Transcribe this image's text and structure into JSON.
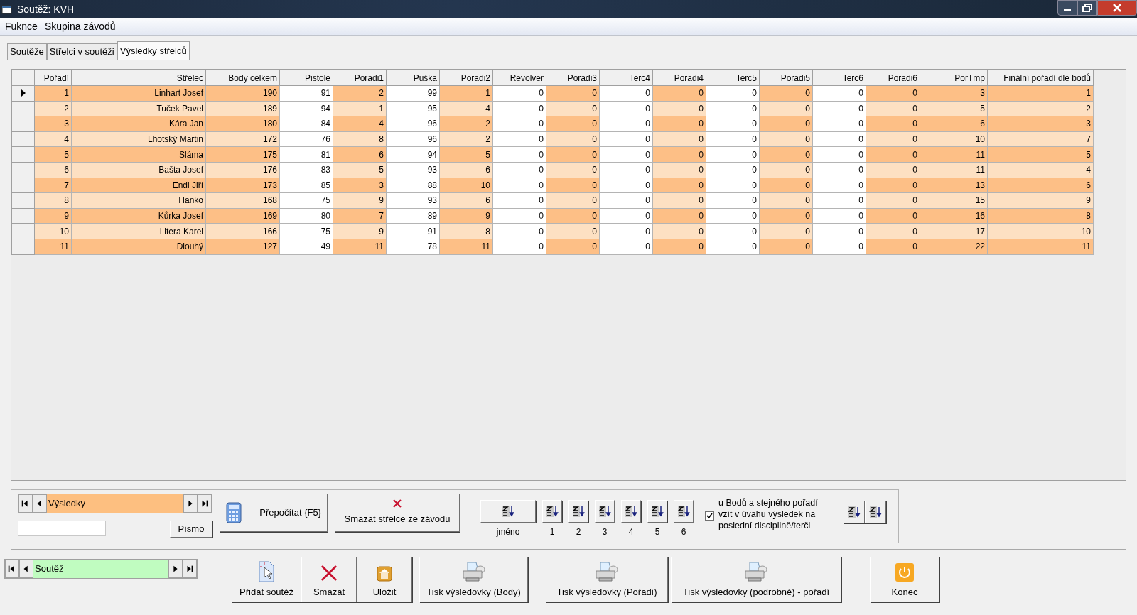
{
  "window": {
    "title": "Soutěž: KVH"
  },
  "menu": [
    "Fuknce",
    "Skupina závodů"
  ],
  "tabs": [
    {
      "label": "Soutěže",
      "selected": false
    },
    {
      "label": "Střelci v soutěži",
      "selected": false
    },
    {
      "label": "Výsledky střelců",
      "selected": true
    }
  ],
  "grid": {
    "columns": [
      {
        "label": "Pořadí",
        "shaded": true
      },
      {
        "label": "Střelec",
        "shaded": true
      },
      {
        "label": "Body celkem",
        "shaded": true
      },
      {
        "label": "Pistole",
        "shaded": false
      },
      {
        "label": "Poradi1",
        "shaded": true
      },
      {
        "label": "Puška",
        "shaded": false
      },
      {
        "label": "Poradi2",
        "shaded": true
      },
      {
        "label": "Revolver",
        "shaded": false
      },
      {
        "label": "Poradi3",
        "shaded": true
      },
      {
        "label": "Terc4",
        "shaded": false
      },
      {
        "label": "Poradi4",
        "shaded": true
      },
      {
        "label": "Terc5",
        "shaded": false
      },
      {
        "label": "Poradi5",
        "shaded": true
      },
      {
        "label": "Terc6",
        "shaded": false
      },
      {
        "label": "Poradi6",
        "shaded": true
      },
      {
        "label": "PorTmp",
        "shaded": true
      },
      {
        "label": "Finální pořadí dle bodů",
        "shaded": true
      }
    ],
    "rows": [
      {
        "selected": true,
        "cells": [
          "1",
          "Linhart Josef",
          "190",
          "91",
          "2",
          "99",
          "1",
          "0",
          "0",
          "0",
          "0",
          "0",
          "0",
          "0",
          "0",
          "3",
          "1"
        ]
      },
      {
        "selected": false,
        "cells": [
          "2",
          "Tuček Pavel",
          "189",
          "94",
          "1",
          "95",
          "4",
          "0",
          "0",
          "0",
          "0",
          "0",
          "0",
          "0",
          "0",
          "5",
          "2"
        ]
      },
      {
        "selected": false,
        "cells": [
          "3",
          "Kára Jan",
          "180",
          "84",
          "4",
          "96",
          "2",
          "0",
          "0",
          "0",
          "0",
          "0",
          "0",
          "0",
          "0",
          "6",
          "3"
        ]
      },
      {
        "selected": false,
        "cells": [
          "4",
          "Lhotský Martin",
          "172",
          "76",
          "8",
          "96",
          "2",
          "0",
          "0",
          "0",
          "0",
          "0",
          "0",
          "0",
          "0",
          "10",
          "7"
        ]
      },
      {
        "selected": false,
        "cells": [
          "5",
          "Sláma",
          "175",
          "81",
          "6",
          "94",
          "5",
          "0",
          "0",
          "0",
          "0",
          "0",
          "0",
          "0",
          "0",
          "11",
          "5"
        ]
      },
      {
        "selected": false,
        "cells": [
          "6",
          "Bašta Josef",
          "176",
          "83",
          "5",
          "93",
          "6",
          "0",
          "0",
          "0",
          "0",
          "0",
          "0",
          "0",
          "0",
          "11",
          "4"
        ]
      },
      {
        "selected": false,
        "cells": [
          "7",
          "Endl Jiří",
          "173",
          "85",
          "3",
          "88",
          "10",
          "0",
          "0",
          "0",
          "0",
          "0",
          "0",
          "0",
          "0",
          "13",
          "6"
        ]
      },
      {
        "selected": false,
        "cells": [
          "8",
          "Hanko",
          "168",
          "75",
          "9",
          "93",
          "6",
          "0",
          "0",
          "0",
          "0",
          "0",
          "0",
          "0",
          "0",
          "15",
          "9"
        ]
      },
      {
        "selected": false,
        "cells": [
          "9",
          "Kůrka Josef",
          "169",
          "80",
          "7",
          "89",
          "9",
          "0",
          "0",
          "0",
          "0",
          "0",
          "0",
          "0",
          "0",
          "16",
          "8"
        ]
      },
      {
        "selected": false,
        "cells": [
          "10",
          "Litera Karel",
          "166",
          "75",
          "9",
          "91",
          "8",
          "0",
          "0",
          "0",
          "0",
          "0",
          "0",
          "0",
          "0",
          "17",
          "10"
        ]
      },
      {
        "selected": false,
        "cells": [
          "11",
          "Dlouhý",
          "127",
          "49",
          "11",
          "78",
          "11",
          "0",
          "0",
          "0",
          "0",
          "0",
          "0",
          "0",
          "0",
          "22",
          "11"
        ]
      }
    ]
  },
  "results_panel": {
    "navigator": {
      "value": "Výsledky",
      "color": "#fdbf80"
    },
    "font_button": "Písmo",
    "recalc_button": "Přepočítat {F5}",
    "delete_button": "Smazat střelce ze závodu",
    "sort_buttons": [
      {
        "label": "jméno",
        "kind": "wide"
      },
      {
        "label": "1",
        "kind": "small"
      },
      {
        "label": "2",
        "kind": "small"
      },
      {
        "label": "3",
        "kind": "small"
      },
      {
        "label": "4",
        "kind": "small"
      },
      {
        "label": "5",
        "kind": "small"
      },
      {
        "label": "6",
        "kind": "small"
      }
    ],
    "tiebreak": {
      "checked": true,
      "label": "u Bodů a stejného pořadí vzít v úvahu výsledek na poslední disciplině/terči"
    }
  },
  "toolbar": {
    "navigator": {
      "value": "Soutěž",
      "color": "#c0fcc0"
    },
    "buttons": [
      {
        "kind": "add",
        "label": "Přidat soutěž"
      },
      {
        "kind": "delete",
        "label": "Smazat"
      },
      {
        "kind": "save",
        "label": "Uložit"
      },
      {
        "kind": "print",
        "label": "Tisk výsledovky (Body)"
      },
      {
        "kind": "print",
        "label": "Tisk výsledovky (Pořadí)"
      },
      {
        "kind": "print",
        "label": "Tisk výsledovky (podrobně) - pořadí"
      },
      {
        "kind": "exit",
        "label": "Konec"
      }
    ]
  }
}
